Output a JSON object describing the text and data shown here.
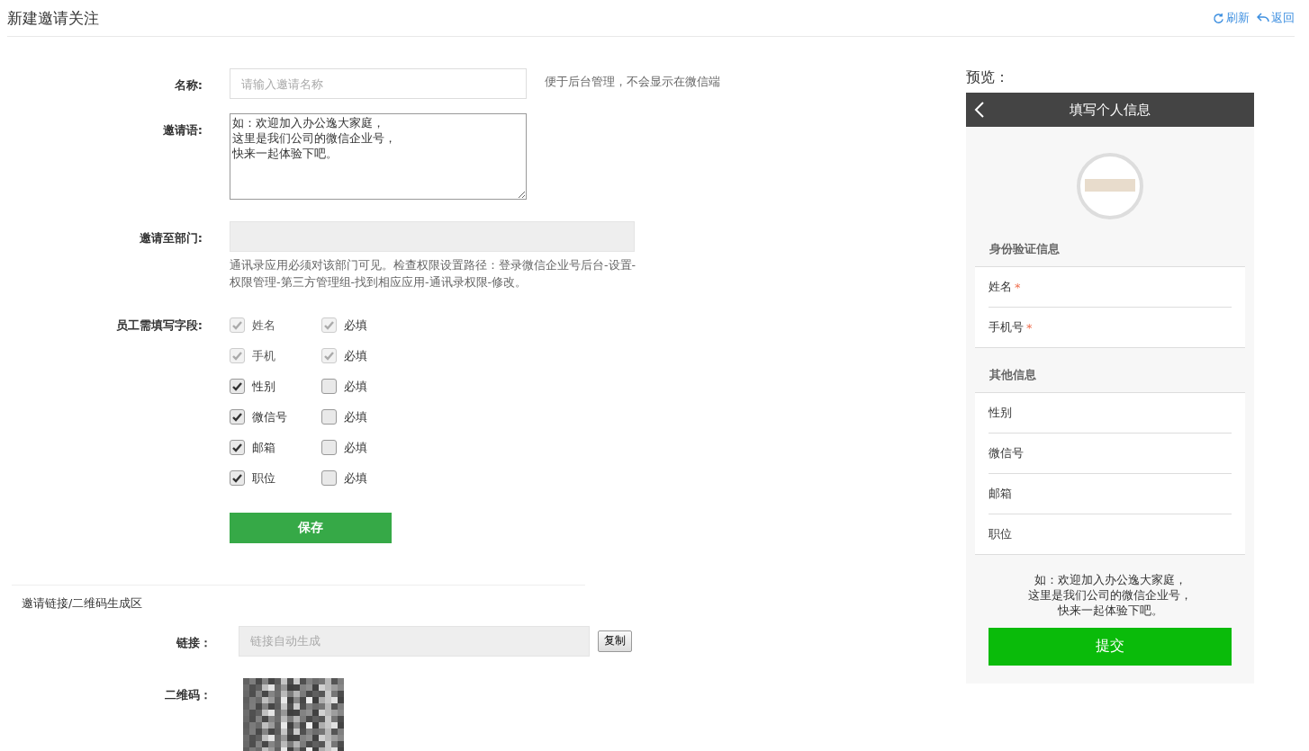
{
  "page": {
    "title": "新建邀请关注",
    "actions": [
      {
        "kind": "refresh",
        "label": "刷新"
      },
      {
        "kind": "back",
        "label": "返回"
      }
    ]
  },
  "form": {
    "name": {
      "label": "名称:",
      "placeholder": "请输入邀请名称",
      "hint": "便于后台管理，不会显示在微信端"
    },
    "greeting": {
      "label": "邀请语:",
      "value_lines": [
        "如：欢迎加入办公逸大家庭，",
        "这里是我们公司的微信企业号，",
        "快来一起体验下吧。"
      ]
    },
    "department": {
      "label": "邀请至部门:",
      "hint": "通讯录应用必须对该部门可见。检查权限设置路径：登录微信企业号后台-设置-权限管理-第三方管理组-找到相应应用-通讯录权限-修改。"
    },
    "fields_label": "员工需填写字段:",
    "fields": [
      {
        "label": "姓名",
        "checked": true,
        "disabled": true,
        "required_label": "必填",
        "required": true,
        "required_disabled": true
      },
      {
        "label": "手机",
        "checked": true,
        "disabled": true,
        "required_label": "必填",
        "required": true,
        "required_disabled": true
      },
      {
        "label": "性别",
        "checked": true,
        "disabled": false,
        "required_label": "必填",
        "required": false,
        "required_disabled": false
      },
      {
        "label": "微信号",
        "checked": true,
        "disabled": false,
        "required_label": "必填",
        "required": false,
        "required_disabled": false
      },
      {
        "label": "邮箱",
        "checked": true,
        "disabled": false,
        "required_label": "必填",
        "required": false,
        "required_disabled": false
      },
      {
        "label": "职位",
        "checked": true,
        "disabled": false,
        "required_label": "必填",
        "required": false,
        "required_disabled": false
      }
    ],
    "save_button": "保存"
  },
  "generate": {
    "title": "邀请链接/二维码生成区",
    "link_label": "链接：",
    "link_placeholder": "链接自动生成",
    "copy_button": "复制",
    "qr_label": "二维码："
  },
  "preview": {
    "title": "预览：",
    "header": "填写个人信息",
    "required_mark": "*",
    "sections": [
      {
        "title": "身份验证信息",
        "rows": [
          {
            "label": "姓名",
            "required": true
          },
          {
            "label": "手机号",
            "required": true
          }
        ]
      },
      {
        "title": "其他信息",
        "rows": [
          {
            "label": "性别",
            "required": false
          },
          {
            "label": "微信号",
            "required": false
          },
          {
            "label": "邮箱",
            "required": false
          },
          {
            "label": "职位",
            "required": false
          }
        ]
      }
    ],
    "message_lines": [
      "如：欢迎加入办公逸大家庭，",
      "这里是我们公司的微信企业号，",
      "快来一起体验下吧。"
    ],
    "submit": "提交"
  }
}
